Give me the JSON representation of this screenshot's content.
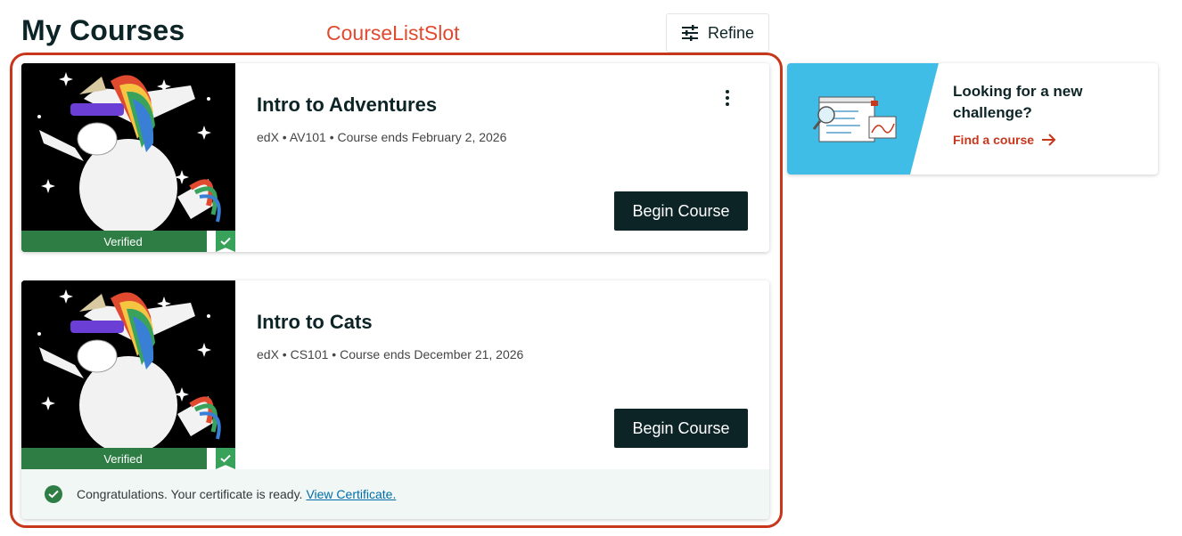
{
  "header": {
    "title": "My Courses",
    "slot_label": "CourseListSlot",
    "refine_label": "Refine",
    "refine_icon": "sliders-icon"
  },
  "courses": [
    {
      "title": "Intro to Adventures",
      "meta": "edX • AV101 • Course ends February 2, 2026",
      "badge": "Verified",
      "action_label": "Begin Course",
      "has_menu": true
    },
    {
      "title": "Intro to Cats",
      "meta": "edX • CS101 • Course ends December 21, 2026",
      "badge": "Verified",
      "action_label": "Begin Course",
      "banner": {
        "text": "Congratulations. Your certificate is ready.",
        "link": "View Certificate."
      }
    }
  ],
  "sidebar": {
    "title": "Looking for a new challenge?",
    "link_label": "Find a course"
  },
  "colors": {
    "primary_dark": "#0d2427",
    "brand_red": "#c8361b",
    "slot_label": "#e04a2f",
    "verified_green": "#2e7d45",
    "illustration_blue": "#3fbde6",
    "link_blue": "#006daa"
  }
}
